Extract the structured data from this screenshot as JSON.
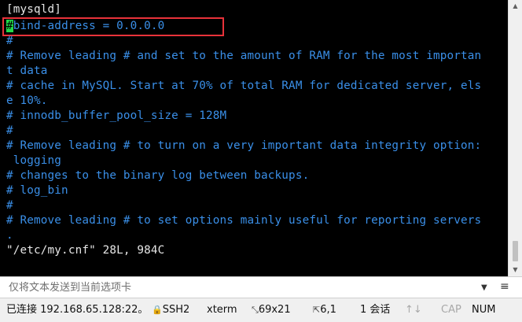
{
  "terminal": {
    "lines": [
      "[mysqld]",
      "bind-address = 0.0.0.0",
      "#",
      "# Remove leading # and set to the amount of RAM for the most importan",
      "t data",
      "# cache in MySQL. Start at 70% of total RAM for dedicated server, els",
      "e 10%.",
      "# innodb_buffer_pool_size = 128M",
      "#",
      "# Remove leading # to turn on a very important data integrity option:",
      " logging",
      "# changes to the binary log between backups.",
      "# log_bin",
      "#",
      "# Remove leading # to set options mainly useful for reporting servers",
      ".",
      "\"/etc/my.cnf\" 28L, 984C"
    ],
    "cursor_char": "#",
    "colors": {
      "background": "#000000",
      "text": "#e6e6e6",
      "comment": "#3a8fe8",
      "cursor": "#22d94a",
      "highlight": "#e8323a"
    }
  },
  "send_bar": {
    "placeholder": "仅将文本发送到当前选项卡",
    "dropdown_icon": "chevron-down-icon",
    "menu_icon": "menu-icon"
  },
  "status": {
    "connection": "已连接 192.168.65.128:22。",
    "protocol": "SSH2",
    "terminal_type": "xterm",
    "size": "69x21",
    "cursor_pos": "6,1",
    "sessions": "1 会话",
    "caps": "CAP",
    "num": "NUM"
  }
}
